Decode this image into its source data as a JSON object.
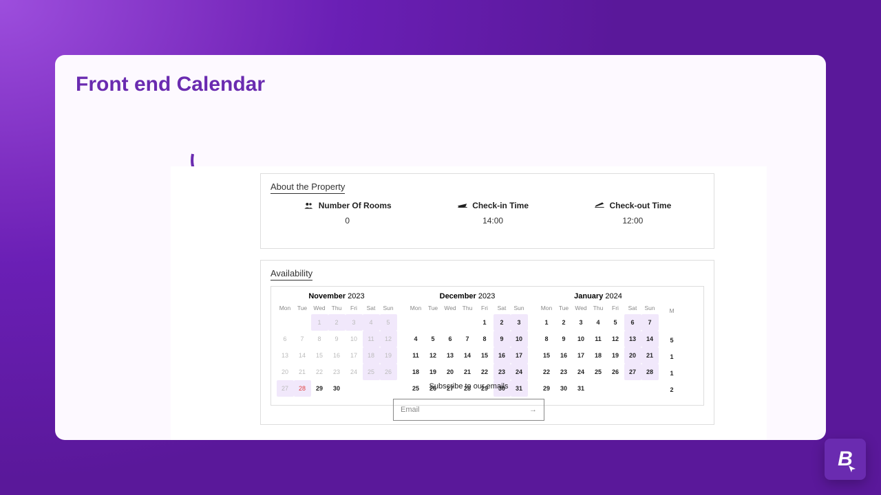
{
  "title": "Front end Calendar",
  "about": {
    "heading": "About the Property",
    "rooms": {
      "label": "Number Of Rooms",
      "value": "0"
    },
    "checkin": {
      "label": "Check-in Time",
      "value": "14:00"
    },
    "checkout": {
      "label": "Check-out Time",
      "value": "12:00"
    }
  },
  "availability": {
    "heading": "Availability"
  },
  "dow": [
    "Mon",
    "Tue",
    "Wed",
    "Thu",
    "Fri",
    "Sat",
    "Sun"
  ],
  "months": [
    {
      "name": "November",
      "year": "2023",
      "days": [
        {
          "n": "",
          "cls": ""
        },
        {
          "n": "",
          "cls": ""
        },
        {
          "n": "1",
          "cls": "muted hl"
        },
        {
          "n": "2",
          "cls": "muted hl"
        },
        {
          "n": "3",
          "cls": "muted hl"
        },
        {
          "n": "4",
          "cls": "muted hl"
        },
        {
          "n": "5",
          "cls": "muted hl"
        },
        {
          "n": "6",
          "cls": "muted"
        },
        {
          "n": "7",
          "cls": "muted"
        },
        {
          "n": "8",
          "cls": "muted"
        },
        {
          "n": "9",
          "cls": "muted"
        },
        {
          "n": "10",
          "cls": "muted"
        },
        {
          "n": "11",
          "cls": "muted hl"
        },
        {
          "n": "12",
          "cls": "muted hl"
        },
        {
          "n": "13",
          "cls": "muted"
        },
        {
          "n": "14",
          "cls": "muted"
        },
        {
          "n": "15",
          "cls": "muted"
        },
        {
          "n": "16",
          "cls": "muted"
        },
        {
          "n": "17",
          "cls": "muted"
        },
        {
          "n": "18",
          "cls": "muted hl"
        },
        {
          "n": "19",
          "cls": "muted hl"
        },
        {
          "n": "20",
          "cls": "muted"
        },
        {
          "n": "21",
          "cls": "muted"
        },
        {
          "n": "22",
          "cls": "muted"
        },
        {
          "n": "23",
          "cls": "muted"
        },
        {
          "n": "24",
          "cls": "muted"
        },
        {
          "n": "25",
          "cls": "muted hl"
        },
        {
          "n": "26",
          "cls": "muted hl"
        },
        {
          "n": "27",
          "cls": "muted hl"
        },
        {
          "n": "28",
          "cls": "red hl"
        },
        {
          "n": "29",
          "cls": "active"
        },
        {
          "n": "30",
          "cls": "active"
        },
        {
          "n": "",
          "cls": ""
        },
        {
          "n": "",
          "cls": ""
        },
        {
          "n": "",
          "cls": ""
        }
      ]
    },
    {
      "name": "December",
      "year": "2023",
      "days": [
        {
          "n": "",
          "cls": ""
        },
        {
          "n": "",
          "cls": ""
        },
        {
          "n": "",
          "cls": ""
        },
        {
          "n": "",
          "cls": ""
        },
        {
          "n": "1",
          "cls": "active"
        },
        {
          "n": "2",
          "cls": "active hl"
        },
        {
          "n": "3",
          "cls": "active hl"
        },
        {
          "n": "4",
          "cls": "active"
        },
        {
          "n": "5",
          "cls": "active"
        },
        {
          "n": "6",
          "cls": "active"
        },
        {
          "n": "7",
          "cls": "active"
        },
        {
          "n": "8",
          "cls": "active"
        },
        {
          "n": "9",
          "cls": "active hl"
        },
        {
          "n": "10",
          "cls": "active hl"
        },
        {
          "n": "11",
          "cls": "active"
        },
        {
          "n": "12",
          "cls": "active"
        },
        {
          "n": "13",
          "cls": "active"
        },
        {
          "n": "14",
          "cls": "active"
        },
        {
          "n": "15",
          "cls": "active"
        },
        {
          "n": "16",
          "cls": "active hl"
        },
        {
          "n": "17",
          "cls": "active hl"
        },
        {
          "n": "18",
          "cls": "active"
        },
        {
          "n": "19",
          "cls": "active"
        },
        {
          "n": "20",
          "cls": "active"
        },
        {
          "n": "21",
          "cls": "active"
        },
        {
          "n": "22",
          "cls": "active"
        },
        {
          "n": "23",
          "cls": "active hl"
        },
        {
          "n": "24",
          "cls": "active hl"
        },
        {
          "n": "25",
          "cls": "active"
        },
        {
          "n": "26",
          "cls": "active"
        },
        {
          "n": "27",
          "cls": "active"
        },
        {
          "n": "28",
          "cls": "active"
        },
        {
          "n": "29",
          "cls": "active"
        },
        {
          "n": "30",
          "cls": "active hl"
        },
        {
          "n": "31",
          "cls": "active hl"
        }
      ]
    },
    {
      "name": "January",
      "year": "2024",
      "days": [
        {
          "n": "1",
          "cls": "active"
        },
        {
          "n": "2",
          "cls": "active"
        },
        {
          "n": "3",
          "cls": "active"
        },
        {
          "n": "4",
          "cls": "active"
        },
        {
          "n": "5",
          "cls": "active"
        },
        {
          "n": "6",
          "cls": "active hl"
        },
        {
          "n": "7",
          "cls": "active hl"
        },
        {
          "n": "8",
          "cls": "active"
        },
        {
          "n": "9",
          "cls": "active"
        },
        {
          "n": "10",
          "cls": "active"
        },
        {
          "n": "11",
          "cls": "active"
        },
        {
          "n": "12",
          "cls": "active"
        },
        {
          "n": "13",
          "cls": "active hl"
        },
        {
          "n": "14",
          "cls": "active hl"
        },
        {
          "n": "15",
          "cls": "active"
        },
        {
          "n": "16",
          "cls": "active"
        },
        {
          "n": "17",
          "cls": "active"
        },
        {
          "n": "18",
          "cls": "active"
        },
        {
          "n": "19",
          "cls": "active"
        },
        {
          "n": "20",
          "cls": "active hl"
        },
        {
          "n": "21",
          "cls": "active hl"
        },
        {
          "n": "22",
          "cls": "active"
        },
        {
          "n": "23",
          "cls": "active"
        },
        {
          "n": "24",
          "cls": "active"
        },
        {
          "n": "25",
          "cls": "active"
        },
        {
          "n": "26",
          "cls": "active"
        },
        {
          "n": "27",
          "cls": "active hl"
        },
        {
          "n": "28",
          "cls": "active hl"
        },
        {
          "n": "29",
          "cls": "active"
        },
        {
          "n": "30",
          "cls": "active"
        },
        {
          "n": "31",
          "cls": "active"
        },
        {
          "n": "",
          "cls": ""
        },
        {
          "n": "",
          "cls": ""
        },
        {
          "n": "",
          "cls": ""
        },
        {
          "n": "",
          "cls": ""
        }
      ]
    }
  ],
  "partial_month": {
    "dow": "M",
    "days": [
      "",
      "5",
      "1",
      "1",
      "2"
    ]
  },
  "subscribe": {
    "title": "Subscribe to our emails",
    "placeholder": "Email"
  },
  "badge": "B"
}
